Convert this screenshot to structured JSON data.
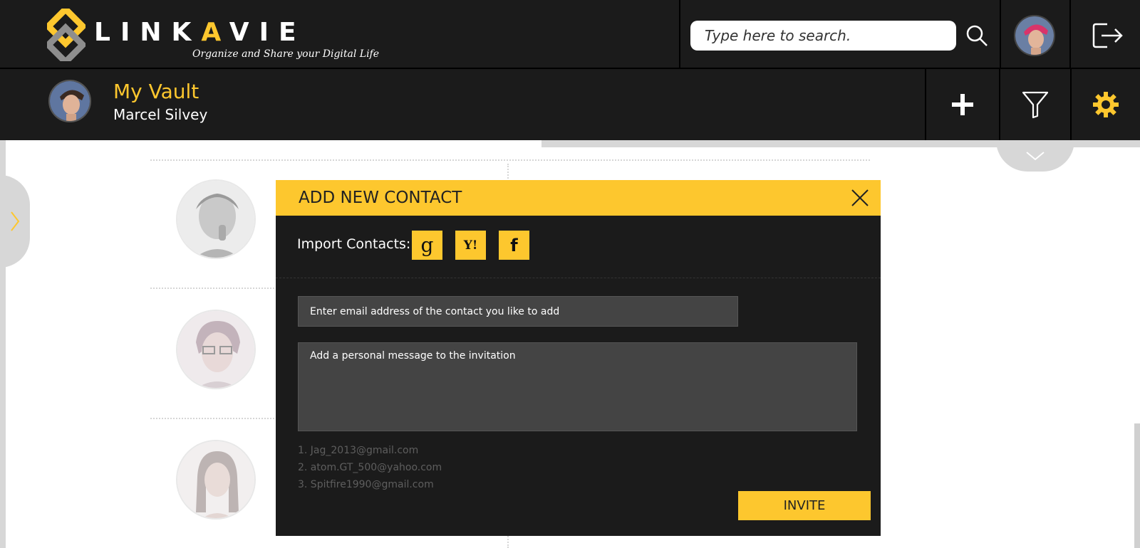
{
  "brand": {
    "name_part1": "LINK",
    "name_accent": "A",
    "name_part2": "VIE",
    "tagline": "Organize and Share your Digital Life",
    "accent_color": "#fdc72e",
    "dark_color": "#1b1b1b"
  },
  "header": {
    "search_placeholder": "Type here to search.",
    "search_icon": "search-icon",
    "logout_icon": "logout-icon",
    "user_avatar": "user-avatar"
  },
  "vault": {
    "title": "My Vault",
    "user_name": "Marcel Silvey",
    "actions": [
      "plus-icon",
      "filter-icon",
      "gear-icon"
    ]
  },
  "modal": {
    "title": "ADD NEW CONTACT",
    "import_label": "Import Contacts:",
    "import_sources": [
      {
        "name": "google",
        "glyph": "g"
      },
      {
        "name": "yahoo",
        "glyph": "Y!"
      },
      {
        "name": "facebook",
        "glyph": "f"
      }
    ],
    "email_placeholder": "Enter email address of the contact you like to add",
    "message_placeholder": "Add a personal message to the invitation",
    "suggestions": [
      "1.  Jag_2013@gmail.com",
      "2.  atom.GT_500@yahoo.com",
      "3.  Spitfire1990@gmail.com"
    ],
    "invite_label": "INVITE"
  }
}
